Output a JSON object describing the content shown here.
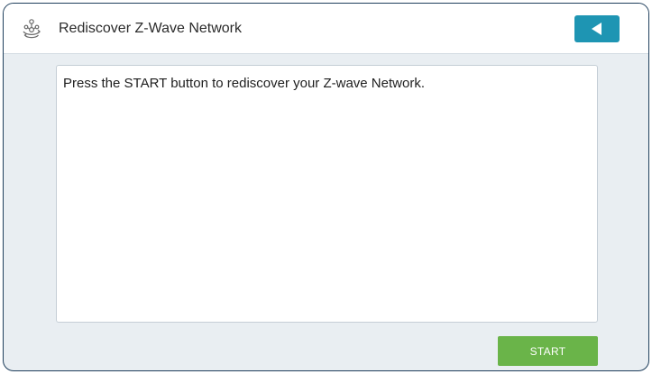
{
  "header": {
    "title": "Rediscover Z-Wave Network",
    "icon": "network-discover-icon",
    "back_button_icon": "back-arrow-icon"
  },
  "main": {
    "message": "Press the START button to rediscover your Z-wave Network."
  },
  "footer": {
    "start_label": "START"
  },
  "colors": {
    "frame_border": "#1f3f5c",
    "background": "#e9eef2",
    "back_button": "#1e95b3",
    "start_button": "#6ab449"
  }
}
